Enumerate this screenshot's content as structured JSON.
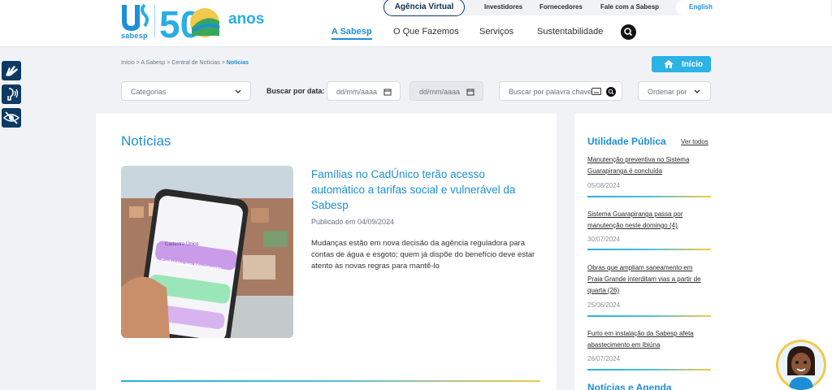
{
  "brand": {
    "logo_text": "sabesp",
    "anniversary_suffix": "anos",
    "anniversary_number": "50"
  },
  "topbar": {
    "agencia_label": "Agência Virtual",
    "links": [
      "Investidores",
      "Fornecedores",
      "Fale com a Sabesp"
    ],
    "language": "English"
  },
  "nav": {
    "items": [
      "A Sabesp",
      "O Que Fazemos",
      "Serviços",
      "Sustentabilidade"
    ],
    "active": "A Sabesp"
  },
  "breadcrumb": {
    "trail": "Início > A Sabesp > Central de Notícias > ",
    "current": "Notícias"
  },
  "home_button": {
    "label": "Início",
    "icon": "home-icon"
  },
  "filters": {
    "category_placeholder": "Categorias",
    "date_label": "Buscar por data:",
    "date_from_placeholder": "dd/mm/aaaa",
    "date_to_placeholder": "dd/mm/aaaa",
    "keyword_placeholder": "Buscar por palavra chave",
    "order_placeholder": "Ordenar por"
  },
  "main": {
    "title": "Notícias",
    "featured": {
      "title": "Famílias no CadÚnico terão acesso automático a tarifas social e vulnerável da Sabesp",
      "date": "Publicado em 04/09/2024",
      "description": "Mudanças estão em nova decisão da agência reguladora para contas de água e esgoto; quem já dispõe do benefício deve estar atento às novas regras para mantê-lo",
      "image_text_1": "Cadastro Único",
      "image_text_2": "Cadastro em Movimento"
    }
  },
  "sidebar": {
    "title": "Utilidade Pública",
    "see_all": "Ver todos",
    "items": [
      {
        "title": "Manutenção preventiva no Sistema Guarapiranga é concluída",
        "date": "05/08/2024"
      },
      {
        "title": "Sistema Guarapiranga passa por manutenção neste domingo (4)",
        "date": "30/07/2024"
      },
      {
        "title": "Obras que ampliam saneamento em Praia Grande interditam vias a partir de quarta (26)",
        "date": "25/06/2024"
      },
      {
        "title": "Furto em instalação da Sabesp afeta abastecimento em Ibiúna",
        "date": "26/07/2024"
      }
    ],
    "next_section_title": "Notícias e Agenda"
  },
  "colors": {
    "accent": "#1e8fd6",
    "accent_light": "#2bb3e6",
    "navy": "#0c3a63",
    "yellow": "#f2c94c"
  }
}
